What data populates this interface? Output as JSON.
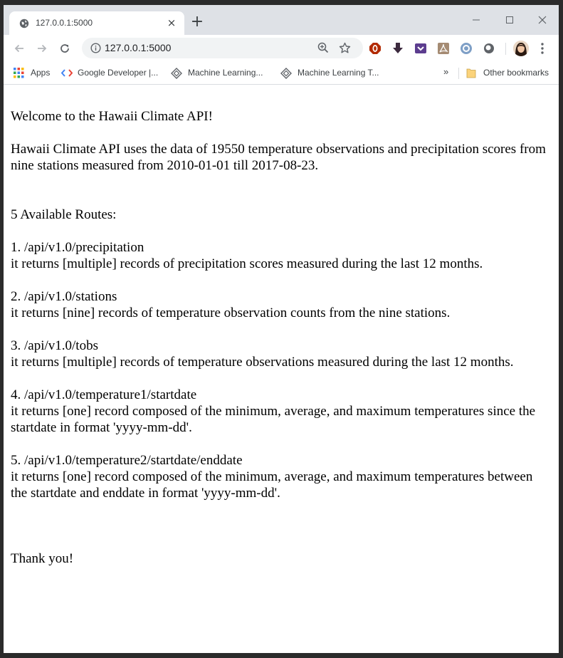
{
  "browser": {
    "tab_title": "127.0.0.1:5000",
    "url": "127.0.0.1:5000",
    "new_tab_symbol": "+",
    "close_symbol": "×"
  },
  "bookmarks": {
    "items": [
      {
        "label": "Apps",
        "icon": "apps-grid-icon"
      },
      {
        "label": "Google Developer |...",
        "icon": "code-brackets-icon"
      },
      {
        "label": "Machine Learning...",
        "icon": "diamond-logo-icon"
      },
      {
        "label": "Machine Learning T...",
        "icon": "diamond-logo-icon"
      }
    ],
    "overflow_symbol": "»",
    "other": "Other bookmarks"
  },
  "page": {
    "welcome": "Welcome to the Hawaii Climate API!",
    "intro": "Hawaii Climate API uses the data of 19550 temperature observations and precipitation scores from nine stations measured from 2010-01-01 till 2017-08-23.",
    "routes_heading": "5 Available Routes:",
    "routes": [
      {
        "path": "1. /api/v1.0/precipitation",
        "desc": "it returns [multiple] records of precipitation scores measured during the last 12 months."
      },
      {
        "path": "2. /api/v1.0/stations",
        "desc": "it returns [nine] records of temperature observation counts from the nine stations."
      },
      {
        "path": "3. /api/v1.0/tobs",
        "desc": "it returns [multiple] records of temperature observations measured during the last 12 months."
      },
      {
        "path": "4. /api/v1.0/temperature1/startdate",
        "desc": "it returns [one] record composed of the minimum, average, and maximum temperatures since the startdate in format 'yyyy-mm-dd'."
      },
      {
        "path": "5. /api/v1.0/temperature2/startdate/enddate",
        "desc": "it returns [one] record composed of the minimum, average, and maximum temperatures between the startdate and enddate in format 'yyyy-mm-dd'."
      }
    ],
    "thanks": "Thank you!"
  }
}
